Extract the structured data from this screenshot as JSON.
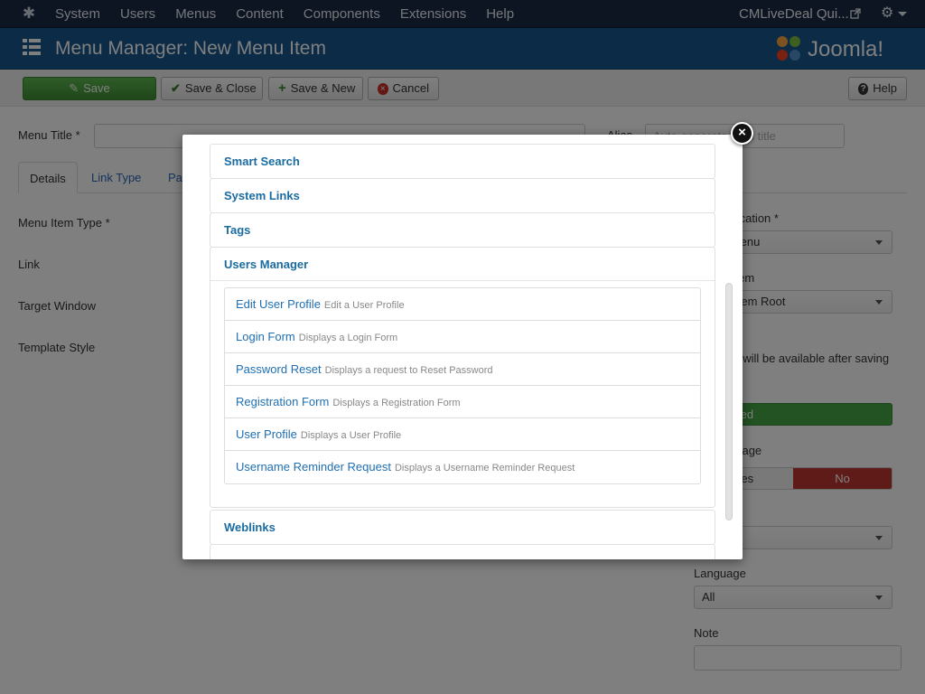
{
  "topnav": {
    "menu": [
      "System",
      "Users",
      "Menus",
      "Content",
      "Components",
      "Extensions",
      "Help"
    ],
    "site_name": "CMLiveDeal Qui...",
    "logo_icon": "joomla-logo-icon",
    "settings_icon": "gear-icon"
  },
  "header": {
    "title": "Menu Manager: New Menu Item",
    "brand": "Joomla!"
  },
  "toolbar": {
    "save": "Save",
    "save_close": "Save & Close",
    "save_new": "Save & New",
    "cancel": "Cancel",
    "help": "Help"
  },
  "form": {
    "menu_title_label": "Menu Title *",
    "alias_label": "Alias",
    "alias_placeholder": "Auto-generate from title",
    "tabs": [
      "Details",
      "Link Type",
      "Pa"
    ],
    "menu_item_type_label": "Menu Item Type *",
    "link_label": "Link",
    "target_window_label": "Target Window",
    "template_style_label": "Template Style",
    "menu_location_label": "Menu Location *",
    "menu_location_value": "Main Menu",
    "parent_item_label": "Parent Item",
    "parent_item_value": "Menu Item Root",
    "ordering_note": "Ordering will be available after saving",
    "status_value": "Published",
    "default_page_label": "Default Page",
    "default_page_yes": "Yes",
    "default_page_no": "No",
    "language_label": "Language",
    "language_value": "All",
    "note_label": "Note"
  },
  "modal": {
    "close_symbol": "×",
    "groups": [
      {
        "label": "Smart Search"
      },
      {
        "label": "System Links"
      },
      {
        "label": "Tags"
      },
      {
        "label": "Users Manager"
      },
      {
        "label": "Weblinks"
      }
    ],
    "users_manager_items": [
      {
        "name": "Edit User Profile",
        "desc": "Edit a User Profile"
      },
      {
        "name": "Login Form",
        "desc": "Displays a Login Form"
      },
      {
        "name": "Password Reset",
        "desc": "Displays a request to Reset Password"
      },
      {
        "name": "Registration Form",
        "desc": "Displays a Registration Form"
      },
      {
        "name": "User Profile",
        "desc": "Displays a User Profile"
      },
      {
        "name": "Username Reminder Request",
        "desc": "Displays a Username Reminder Request"
      }
    ]
  },
  "colors": {
    "navbar": "#1b2b44",
    "header": "#17568c",
    "save_green": "#46a546",
    "link_blue": "#1f6fb2",
    "no_red": "#bd362f"
  }
}
